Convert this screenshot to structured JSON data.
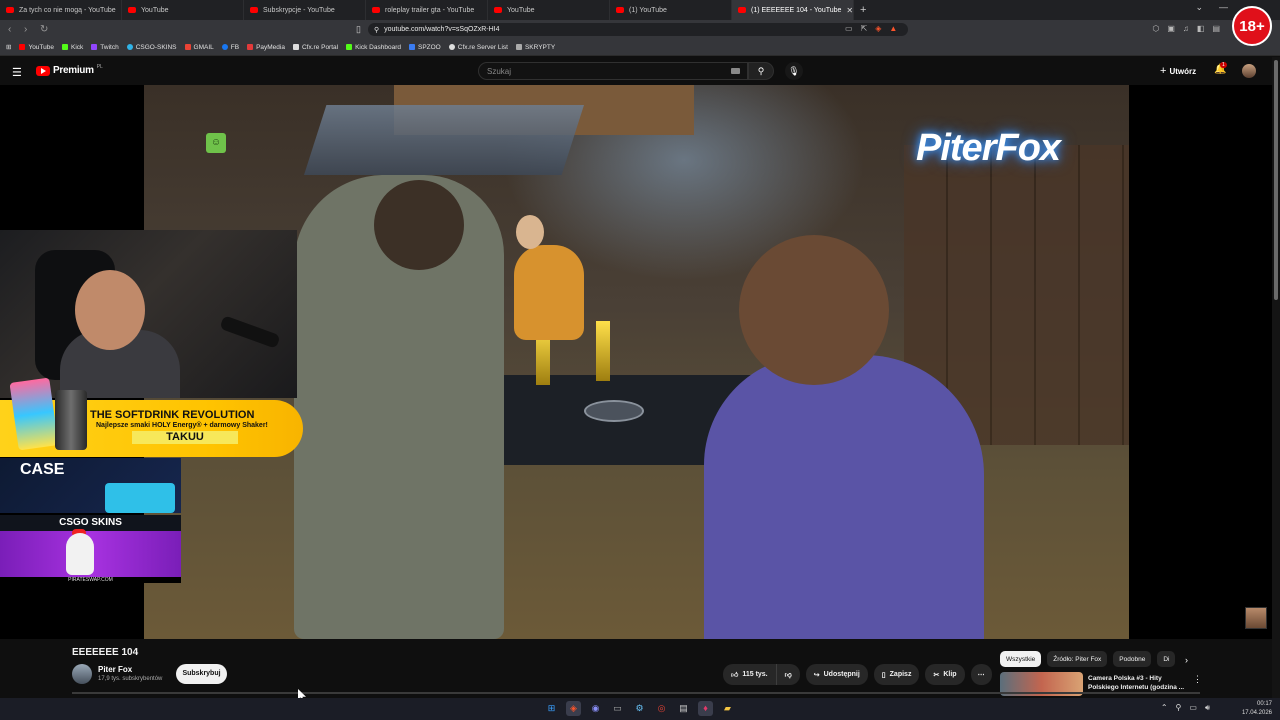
{
  "browser": {
    "tabs": [
      {
        "title": "Za tych co nie mogą - YouTube",
        "active": false
      },
      {
        "title": "YouTube",
        "active": false
      },
      {
        "title": "Subskrypcje - YouTube",
        "active": false
      },
      {
        "title": "roleplay trailer gta - YouTube",
        "active": false
      },
      {
        "title": "YouTube",
        "active": false
      },
      {
        "title": "(1) YouTube",
        "active": false
      },
      {
        "title": "(1) EEEEEEE 104 - YouTube",
        "active": true
      }
    ],
    "url": "youtube.com/watch?v=sSqOZxR-HI4",
    "age_badge": "18+",
    "bookmarks": [
      {
        "label": "YouTube",
        "color": "#ff0000"
      },
      {
        "label": "Kick",
        "color": "#53fc18"
      },
      {
        "label": "Twitch",
        "color": "#9146ff"
      },
      {
        "label": "CSGO-SKINS",
        "color": "#30b4e8"
      },
      {
        "label": "GMAIL",
        "color": "#ea4335"
      },
      {
        "label": "FB",
        "color": "#1877f2"
      },
      {
        "label": "PayMedia",
        "color": "#e23a3a"
      },
      {
        "label": "Cfx.re Portal",
        "color": "#dddddd"
      },
      {
        "label": "Kick Dashboard",
        "color": "#53fc18"
      },
      {
        "label": "SPZOO",
        "color": "#3a7cf2"
      },
      {
        "label": "Cfx.re Server List",
        "color": "#dddddd"
      },
      {
        "label": "SKRYPTY",
        "color": "#aaaaaa"
      }
    ]
  },
  "yt_header": {
    "logo_text": "Premium",
    "logo_country": "PL",
    "search_placeholder": "Szukaj",
    "create_label": "Utwórz",
    "notification_count": "1"
  },
  "video_overlay": {
    "brand_text": "PiterFox",
    "promo_title": "THE SOFTDRINK REVOLUTION",
    "promo_subtitle": "Najlepsze smaki HOLY Energy® + darmowy Shaker!",
    "promo_code": "TAKUU",
    "case_label": "CASE",
    "csgo_label": "CSGO SKINS",
    "pirate_url": "PIRATESWAP.COM"
  },
  "video": {
    "title": "EEEEEEE 104",
    "channel_name": "Piter Fox",
    "channel_subs": "17,9 tys. subskrybentów",
    "subscribe_label": "Subskrybuj",
    "likes": "115 tys.",
    "share_label": "Udostępnij",
    "save_label": "Zapisz",
    "clip_label": "Klip"
  },
  "recommendations": {
    "chips": [
      "Wszystkie",
      "Źródło: Piter Fox",
      "Podobne",
      "Di"
    ],
    "first_title": "Camera Polska #3 - Hity Polskiego Internetu (godzina ..."
  },
  "taskbar": {
    "time": "00:17",
    "date": "17.04.2026"
  },
  "colors": {
    "yt_red": "#ff0000",
    "background": "#0f0f0f",
    "promo_yellow": "#ffc300",
    "brand_glow": "#2a7cff"
  }
}
